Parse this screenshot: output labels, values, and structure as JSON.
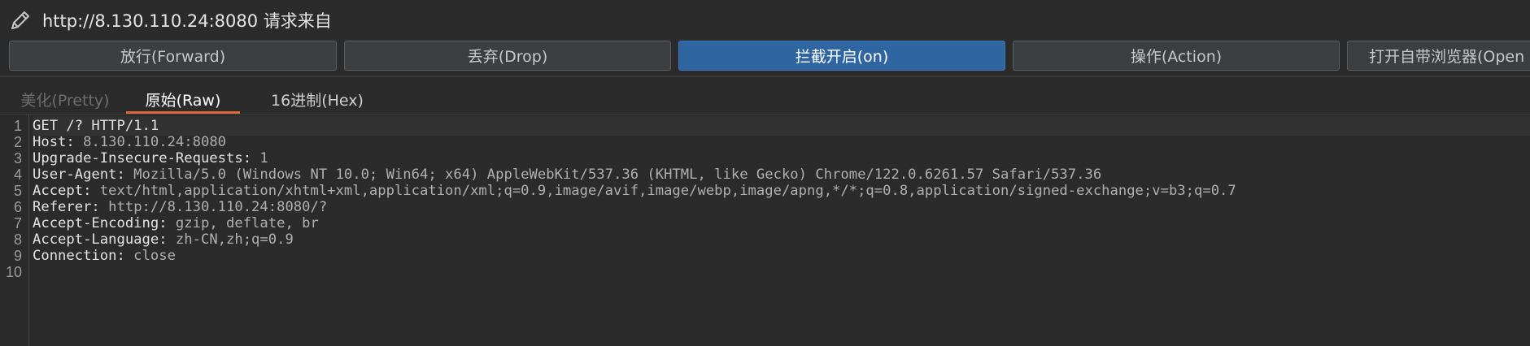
{
  "header": {
    "title": "http://8.130.110.24:8080 请求来自",
    "icon": "pencil-icon"
  },
  "toolbar": {
    "forward": "放行(Forward)",
    "drop": "丢弃(Drop)",
    "intercept": "拦截开启(on)",
    "action": "操作(Action)",
    "open_browser": "打开自带浏览器(Open"
  },
  "tabs": {
    "pretty": "美化(Pretty)",
    "raw": "原始(Raw)",
    "hex": "16进制(Hex)",
    "active": "raw"
  },
  "request": {
    "line_numbers": [
      "1",
      "2",
      "3",
      "4",
      "5",
      "6",
      "7",
      "8",
      "9",
      "10"
    ],
    "lines": [
      {
        "key": "GET /? HTTP/1.1",
        "value": ""
      },
      {
        "key": "Host:",
        "value": " 8.130.110.24:8080"
      },
      {
        "key": "Upgrade-Insecure-Requests:",
        "value": " 1"
      },
      {
        "key": "User-Agent:",
        "value": " Mozilla/5.0 (Windows NT 10.0; Win64; x64) AppleWebKit/537.36 (KHTML, like Gecko) Chrome/122.0.6261.57 Safari/537.36"
      },
      {
        "key": "Accept:",
        "value": " text/html,application/xhtml+xml,application/xml;q=0.9,image/avif,image/webp,image/apng,*/*;q=0.8,application/signed-exchange;v=b3;q=0.7"
      },
      {
        "key": "Referer:",
        "value": " http://8.130.110.24:8080/?"
      },
      {
        "key": "Accept-Encoding:",
        "value": " gzip, deflate, br"
      },
      {
        "key": "Accept-Language:",
        "value": " zh-CN,zh;q=0.9"
      },
      {
        "key": "Connection:",
        "value": " close"
      },
      {
        "key": "",
        "value": ""
      }
    ]
  },
  "colors": {
    "accent_blue": "#2f65a0",
    "tab_underline": "#e0673a",
    "background": "#2b2b2b"
  }
}
